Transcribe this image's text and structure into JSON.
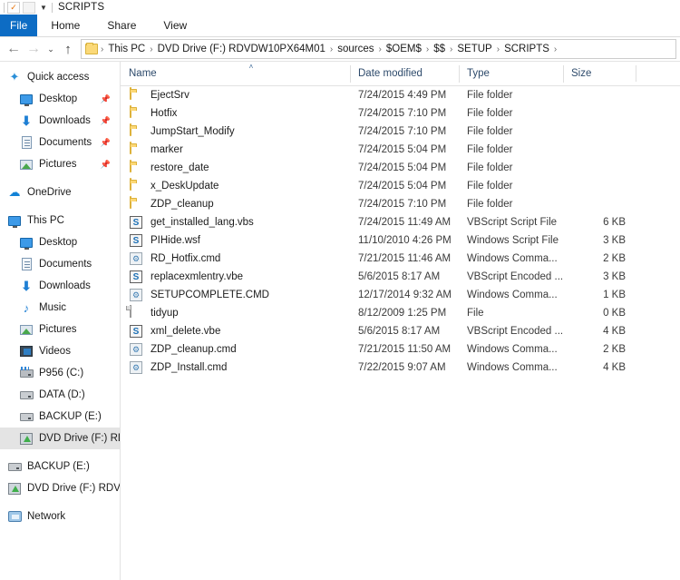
{
  "window": {
    "title": "SCRIPTS",
    "quick_access": [
      {
        "name": "properties-icon",
        "glyph": "✓"
      },
      {
        "name": "new-folder-icon",
        "glyph": ""
      },
      {
        "name": "customize-qat-chevron-icon",
        "glyph": "▾"
      }
    ]
  },
  "ribbon": {
    "file_tab": "File",
    "tabs": [
      "Home",
      "Share",
      "View"
    ]
  },
  "navigation": {
    "back": "←",
    "forward": "→",
    "history": "⌄",
    "up": "↑",
    "breadcrumbs": [
      "This PC",
      "DVD Drive (F:) RDVDW10PX64M01",
      "sources",
      "$OEM$",
      "$$",
      "SETUP",
      "SCRIPTS"
    ],
    "separator": "›"
  },
  "sidebar": {
    "groups": [
      {
        "items": [
          {
            "label": "Quick access",
            "icon": "star-pin-icon",
            "indent": false,
            "pinned": false,
            "selected": false
          },
          {
            "label": "Desktop",
            "icon": "monitor-icon",
            "indent": true,
            "pinned": true,
            "selected": false
          },
          {
            "label": "Downloads",
            "icon": "download-arrow-icon",
            "indent": true,
            "pinned": true,
            "selected": false
          },
          {
            "label": "Documents",
            "icon": "document-icon",
            "indent": true,
            "pinned": true,
            "selected": false
          },
          {
            "label": "Pictures",
            "icon": "picture-icon",
            "indent": true,
            "pinned": true,
            "selected": false
          }
        ]
      },
      {
        "items": [
          {
            "label": "OneDrive",
            "icon": "cloud-icon",
            "indent": false,
            "pinned": false,
            "selected": false
          }
        ]
      },
      {
        "items": [
          {
            "label": "This PC",
            "icon": "monitor-icon",
            "indent": false,
            "pinned": false,
            "selected": false
          },
          {
            "label": "Desktop",
            "icon": "monitor-icon",
            "indent": true,
            "pinned": false,
            "selected": false
          },
          {
            "label": "Documents",
            "icon": "document-icon",
            "indent": true,
            "pinned": false,
            "selected": false
          },
          {
            "label": "Downloads",
            "icon": "download-arrow-icon",
            "indent": true,
            "pinned": false,
            "selected": false
          },
          {
            "label": "Music",
            "icon": "music-note-icon",
            "indent": true,
            "pinned": false,
            "selected": false
          },
          {
            "label": "Pictures",
            "icon": "picture-icon",
            "indent": true,
            "pinned": false,
            "selected": false
          },
          {
            "label": "Videos",
            "icon": "video-icon",
            "indent": true,
            "pinned": false,
            "selected": false
          },
          {
            "label": "P956 (C:)",
            "icon": "system-drive-icon",
            "indent": true,
            "pinned": false,
            "selected": false
          },
          {
            "label": "DATA (D:)",
            "icon": "drive-icon",
            "indent": true,
            "pinned": false,
            "selected": false
          },
          {
            "label": "BACKUP (E:)",
            "icon": "drive-icon",
            "indent": true,
            "pinned": false,
            "selected": false
          },
          {
            "label": "DVD Drive (F:) RDVD",
            "icon": "dvd-drive-icon",
            "indent": true,
            "pinned": false,
            "selected": true
          }
        ]
      },
      {
        "items": [
          {
            "label": "BACKUP (E:)",
            "icon": "drive-icon",
            "indent": false,
            "pinned": false,
            "selected": false
          },
          {
            "label": "DVD Drive (F:) RDVDW",
            "icon": "dvd-drive-icon",
            "indent": false,
            "pinned": false,
            "selected": false
          }
        ]
      },
      {
        "items": [
          {
            "label": "Network",
            "icon": "network-icon",
            "indent": false,
            "pinned": false,
            "selected": false
          }
        ]
      }
    ]
  },
  "filelist": {
    "columns": [
      "Name",
      "Date modified",
      "Type",
      "Size"
    ],
    "sort_indicator": "˄",
    "rows": [
      {
        "name": "EjectSrv",
        "date": "7/24/2015 4:49 PM",
        "type": "File folder",
        "size": "",
        "icon": "folder-icon"
      },
      {
        "name": "Hotfix",
        "date": "7/24/2015 7:10 PM",
        "type": "File folder",
        "size": "",
        "icon": "folder-icon"
      },
      {
        "name": "JumpStart_Modify",
        "date": "7/24/2015 7:10 PM",
        "type": "File folder",
        "size": "",
        "icon": "folder-icon"
      },
      {
        "name": "marker",
        "date": "7/24/2015 5:04 PM",
        "type": "File folder",
        "size": "",
        "icon": "folder-icon"
      },
      {
        "name": "restore_date",
        "date": "7/24/2015 5:04 PM",
        "type": "File folder",
        "size": "",
        "icon": "folder-icon"
      },
      {
        "name": "x_DeskUpdate",
        "date": "7/24/2015 5:04 PM",
        "type": "File folder",
        "size": "",
        "icon": "folder-icon"
      },
      {
        "name": "ZDP_cleanup",
        "date": "7/24/2015 7:10 PM",
        "type": "File folder",
        "size": "",
        "icon": "folder-icon"
      },
      {
        "name": "get_installed_lang.vbs",
        "date": "7/24/2015 11:49 AM",
        "type": "VBScript Script File",
        "size": "6 KB",
        "icon": "vbscript-icon"
      },
      {
        "name": "PIHide.wsf",
        "date": "11/10/2010 4:26 PM",
        "type": "Windows Script File",
        "size": "3 KB",
        "icon": "vbscript-icon"
      },
      {
        "name": "RD_Hotfix.cmd",
        "date": "7/21/2015 11:46 AM",
        "type": "Windows Comma...",
        "size": "2 KB",
        "icon": "command-icon"
      },
      {
        "name": "replacexmlentry.vbe",
        "date": "5/6/2015 8:17 AM",
        "type": "VBScript Encoded ...",
        "size": "3 KB",
        "icon": "vbscript-icon"
      },
      {
        "name": "SETUPCOMPLETE.CMD",
        "date": "12/17/2014 9:32 AM",
        "type": "Windows Comma...",
        "size": "1 KB",
        "icon": "command-icon"
      },
      {
        "name": "tidyup",
        "date": "8/12/2009 1:25 PM",
        "type": "File",
        "size": "0 KB",
        "icon": "blank-file-icon"
      },
      {
        "name": "xml_delete.vbe",
        "date": "5/6/2015 8:17 AM",
        "type": "VBScript Encoded ...",
        "size": "4 KB",
        "icon": "vbscript-icon"
      },
      {
        "name": "ZDP_cleanup.cmd",
        "date": "7/21/2015 11:50 AM",
        "type": "Windows Comma...",
        "size": "2 KB",
        "icon": "command-icon"
      },
      {
        "name": "ZDP_Install.cmd",
        "date": "7/22/2015 9:07 AM",
        "type": "Windows Comma...",
        "size": "4 KB",
        "icon": "command-icon"
      }
    ]
  },
  "colors": {
    "file_tab_blue": "#0d6cc4",
    "header_text": "#2d4a6b",
    "selection_grey": "#e4e4e4",
    "folder_yellow": "#fcd877"
  }
}
